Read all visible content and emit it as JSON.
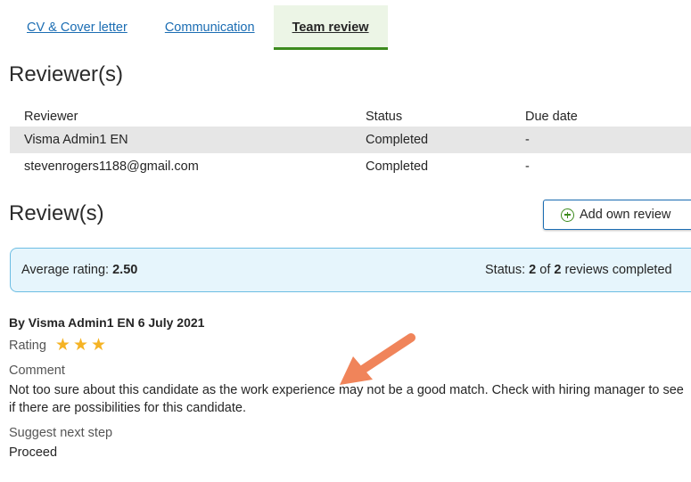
{
  "tabs": [
    {
      "label": "CV & Cover letter"
    },
    {
      "label": "Communication"
    },
    {
      "label": "Team review",
      "active": true
    }
  ],
  "reviewers_section": {
    "title": "Reviewer(s)",
    "columns": [
      "Reviewer",
      "Status",
      "Due date"
    ],
    "rows": [
      {
        "reviewer": "Visma Admin1 EN",
        "status": "Completed",
        "due": "-"
      },
      {
        "reviewer": "stevenrogers1188@gmail.com",
        "status": "Completed",
        "due": "-"
      }
    ]
  },
  "reviews_section": {
    "title": "Review(s)",
    "add_button": "Add own review",
    "average_label": "Average rating:",
    "average_value": "2.50",
    "status_label": "Status:",
    "status_completed": "2",
    "status_of": "of",
    "status_total": "2",
    "status_suffix": "reviews completed"
  },
  "review": {
    "author_line": "By Visma Admin1 EN 6 July 2021",
    "rating_label": "Rating",
    "rating_value": 3,
    "comment_label": "Comment",
    "comment": "Not too sure about this candidate as the work experience may not be a good match. Check with hiring manager to see if there are possibilities for this candidate.",
    "next_step_label": "Suggest next step",
    "next_step": "Proceed"
  },
  "colors": {
    "link": "#1b6db3",
    "active_tab_underline": "#3d8b1e",
    "star": "#f5b324",
    "summary_bg": "#e6f5fc",
    "summary_border": "#6cbde3",
    "annotation_arrow": "#f0845a"
  },
  "icons": {
    "add": "plus-circle-icon",
    "star": "star-icon",
    "annotation": "arrow-annotation"
  }
}
